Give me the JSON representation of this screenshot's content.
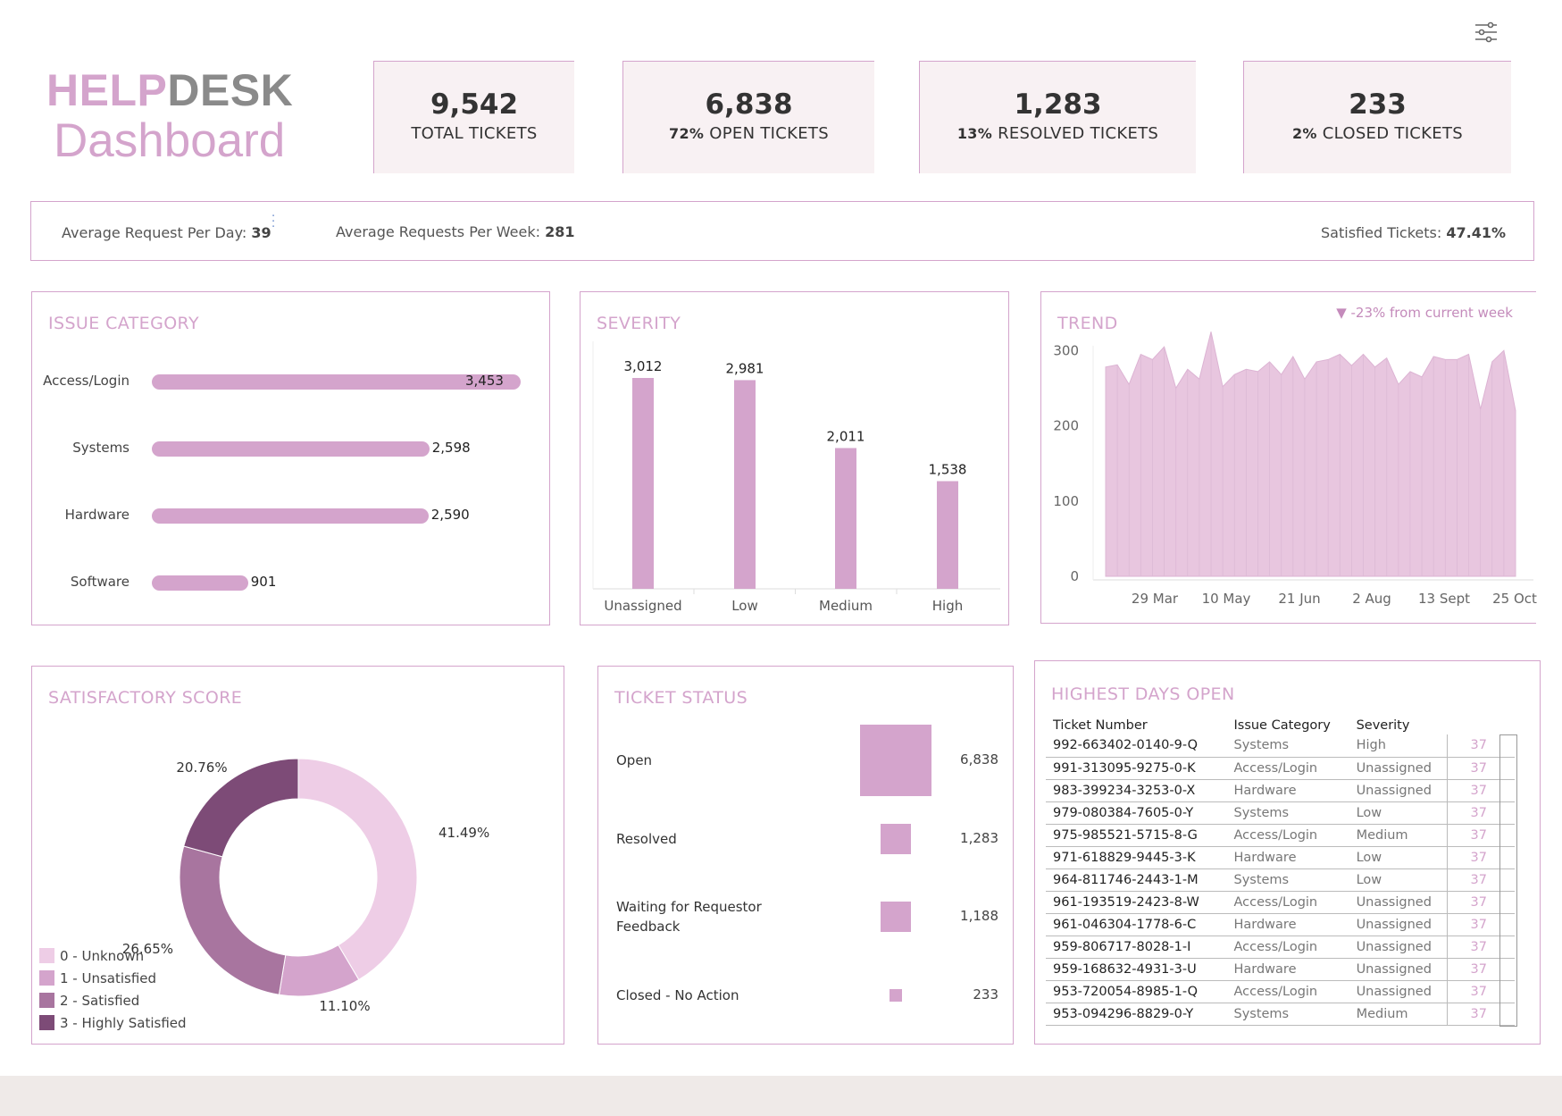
{
  "brand": {
    "part1": "HELP",
    "part2": "DESK",
    "subtitle": "Dashboard"
  },
  "settings": {
    "icon": "sliders-icon"
  },
  "kpis": [
    {
      "value": "9,542",
      "pct": "",
      "label": "TOTAL TICKETS"
    },
    {
      "value": "6,838",
      "pct": "72%",
      "label": "OPEN TICKETS"
    },
    {
      "value": "1,283",
      "pct": "13%",
      "label": "RESOLVED TICKETS"
    },
    {
      "value": "233",
      "pct": "2%",
      "label": "CLOSED TICKETS"
    }
  ],
  "averages": {
    "per_day_label": "Average Request Per Day:",
    "per_day_value": "39",
    "per_week_label": "Average Requests Per Week:",
    "per_week_value": "281",
    "satisfied_label": "Satisfied Tickets:",
    "satisfied_value": "47.41%"
  },
  "issue_category": {
    "title": "ISSUE CATEGORY",
    "chart_data": {
      "type": "bar",
      "orientation": "horizontal",
      "categories": [
        "Access/Login",
        "Systems",
        "Hardware",
        "Software"
      ],
      "values": [
        3453,
        2598,
        2590,
        901
      ],
      "labels": [
        "3,453",
        "2,598",
        "2,590",
        "901"
      ]
    }
  },
  "severity": {
    "title": "SEVERITY",
    "chart_data": {
      "type": "bar",
      "categories": [
        "Unassigned",
        "Low",
        "Medium",
        "High"
      ],
      "values": [
        3012,
        2981,
        2011,
        1538
      ],
      "labels": [
        "3,012",
        "2,981",
        "2,011",
        "1,538"
      ]
    }
  },
  "trend": {
    "title": "TREND",
    "note": "▼ -23% from current week",
    "chart_data": {
      "type": "area",
      "ylim": [
        0,
        330
      ],
      "yticks": [
        "0",
        "100",
        "200",
        "300"
      ],
      "xticks": [
        "29 Mar",
        "10 May",
        "21 Jun",
        "2 Aug",
        "13 Sept",
        "25 Oct"
      ],
      "values": [
        278,
        281,
        255,
        295,
        288,
        305,
        250,
        275,
        262,
        325,
        252,
        268,
        275,
        272,
        285,
        268,
        292,
        262,
        285,
        288,
        295,
        280,
        295,
        278,
        290,
        255,
        272,
        265,
        292,
        288,
        288,
        295,
        222,
        285,
        300,
        220
      ]
    }
  },
  "satisfaction": {
    "title": "SATISFACTORY SCORE",
    "chart_data": {
      "type": "pie",
      "categories": [
        "0 - Unknown",
        "1 - Unsatisfied",
        "2 - Satisfied",
        "3 - Highly Satisfied"
      ],
      "values": [
        41.49,
        11.1,
        26.65,
        20.76
      ],
      "labels": [
        "41.49%",
        "11.10%",
        "26.65%",
        "20.76%"
      ],
      "colors": [
        "#eecde6",
        "#d4a4cc",
        "#a8759f",
        "#7d4b77"
      ]
    }
  },
  "ticket_status": {
    "title": "TICKET STATUS",
    "items": [
      {
        "label": "Open",
        "value": 6838,
        "display": "6,838"
      },
      {
        "label": "Resolved",
        "value": 1283,
        "display": "1,283"
      },
      {
        "label": "Waiting for Requestor Feedback",
        "value": 1188,
        "display": "1,188"
      },
      {
        "label": "Closed - No Action",
        "value": 233,
        "display": "233"
      }
    ]
  },
  "days_open": {
    "title": "HIGHEST DAYS OPEN",
    "columns": [
      "Ticket Number",
      "Issue Category",
      "Severity",
      ""
    ],
    "rows": [
      [
        "992-663402-0140-9-Q",
        "Systems",
        "High",
        "37"
      ],
      [
        "991-313095-9275-0-K",
        "Access/Login",
        "Unassigned",
        "37"
      ],
      [
        "983-399234-3253-0-X",
        "Hardware",
        "Unassigned",
        "37"
      ],
      [
        "979-080384-7605-0-Y",
        "Systems",
        "Low",
        "37"
      ],
      [
        "975-985521-5715-8-G",
        "Access/Login",
        "Medium",
        "37"
      ],
      [
        "971-618829-9445-3-K",
        "Hardware",
        "Low",
        "37"
      ],
      [
        "964-811746-2443-1-M",
        "Systems",
        "Low",
        "37"
      ],
      [
        "961-193519-2423-8-W",
        "Access/Login",
        "Unassigned",
        "37"
      ],
      [
        "961-046304-1778-6-C",
        "Hardware",
        "Unassigned",
        "37"
      ],
      [
        "959-806717-8028-1-I",
        "Access/Login",
        "Unassigned",
        "37"
      ],
      [
        "959-168632-4931-3-U",
        "Hardware",
        "Unassigned",
        "37"
      ],
      [
        "953-720054-8985-1-Q",
        "Access/Login",
        "Unassigned",
        "37"
      ],
      [
        "953-094296-8829-0-Y",
        "Systems",
        "Medium",
        "37"
      ]
    ]
  }
}
